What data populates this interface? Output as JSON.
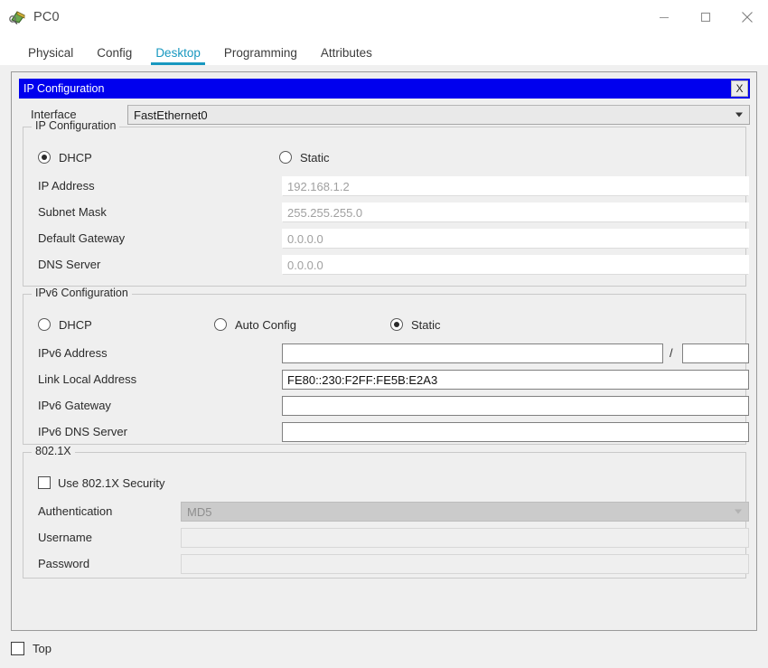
{
  "window": {
    "title": "PC0",
    "icon": "pc-device-icon",
    "controls": {
      "minimize": "minimize-icon",
      "maximize": "maximize-icon",
      "close": "close-icon"
    }
  },
  "tabs": [
    {
      "label": "Physical",
      "active": false
    },
    {
      "label": "Config",
      "active": false
    },
    {
      "label": "Desktop",
      "active": true
    },
    {
      "label": "Programming",
      "active": false
    },
    {
      "label": "Attributes",
      "active": false
    }
  ],
  "accent_color": "#1898c0",
  "caption_color": "#0000ee",
  "dialog": {
    "caption": "IP Configuration",
    "close_label": "X"
  },
  "interface": {
    "label": "Interface",
    "value": "FastEthernet0"
  },
  "ipv4": {
    "group_label": "IP Configuration",
    "mode_dhcp": {
      "label": "DHCP",
      "selected": true
    },
    "mode_static": {
      "label": "Static",
      "selected": false
    },
    "fields": [
      {
        "label": "IP Address",
        "value": "192.168.1.2",
        "enabled": false
      },
      {
        "label": "Subnet Mask",
        "value": "255.255.255.0",
        "enabled": false
      },
      {
        "label": "Default Gateway",
        "value": "0.0.0.0",
        "enabled": false
      },
      {
        "label": "DNS Server",
        "value": "0.0.0.0",
        "enabled": false
      }
    ]
  },
  "ipv6": {
    "group_label": "IPv6 Configuration",
    "mode_dhcp": {
      "label": "DHCP",
      "selected": false
    },
    "mode_auto": {
      "label": "Auto Config",
      "selected": false
    },
    "mode_static": {
      "label": "Static",
      "selected": true
    },
    "address_label": "IPv6 Address",
    "address_value": "",
    "prefix_separator": "/",
    "prefix_value": "",
    "link_local_label": "Link Local Address",
    "link_local_value": "FE80::230:F2FF:FE5B:E2A3",
    "gateway_label": "IPv6 Gateway",
    "gateway_value": "",
    "dns_label": "IPv6 DNS Server",
    "dns_value": ""
  },
  "dot1x": {
    "group_label": "802.1X",
    "use_security": {
      "label": "Use 802.1X Security",
      "checked": false
    },
    "authentication_label": "Authentication",
    "authentication_value": "MD5",
    "username_label": "Username",
    "username_value": "",
    "password_label": "Password",
    "password_value": ""
  },
  "footer": {
    "top_label": "Top",
    "top_checked": false
  }
}
